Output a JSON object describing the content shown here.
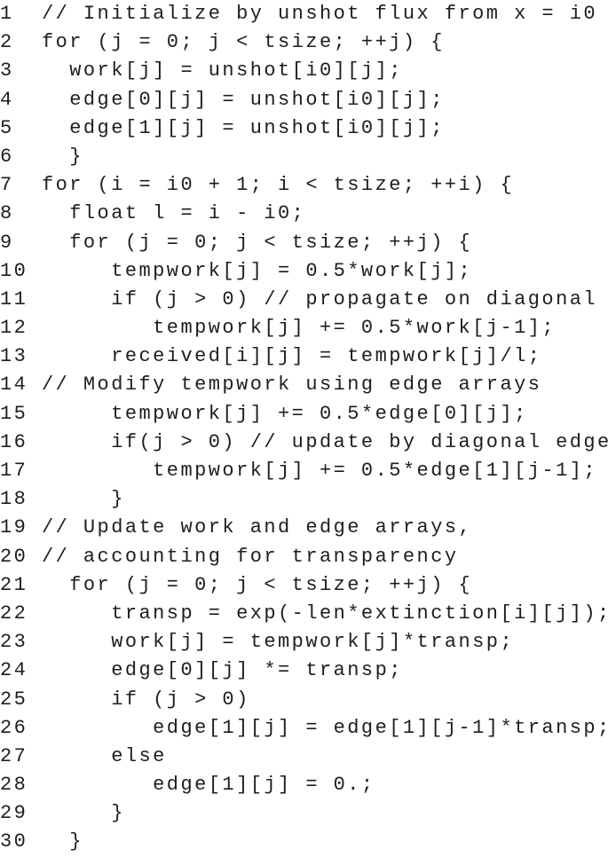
{
  "code_listing": {
    "lines": [
      {
        "number": "1",
        "code": "// Initialize by unshot flux from x = i0"
      },
      {
        "number": "2",
        "code": "for (j = 0; j < tsize; ++j) {"
      },
      {
        "number": "3",
        "code": "  work[j] = unshot[i0][j];"
      },
      {
        "number": "4",
        "code": "  edge[0][j] = unshot[i0][j];"
      },
      {
        "number": "5",
        "code": "  edge[1][j] = unshot[i0][j];"
      },
      {
        "number": "6",
        "code": "  }"
      },
      {
        "number": "7",
        "code": "for (i = i0 + 1; i < tsize; ++i) {"
      },
      {
        "number": "8",
        "code": "  float l = i - i0;"
      },
      {
        "number": "9",
        "code": "  for (j = 0; j < tsize; ++j) {"
      },
      {
        "number": "10",
        "code": "     tempwork[j] = 0.5*work[j];"
      },
      {
        "number": "11",
        "code": "     if (j > 0) // propagate on diagonal"
      },
      {
        "number": "12",
        "code": "        tempwork[j] += 0.5*work[j-1];"
      },
      {
        "number": "13",
        "code": "     received[i][j] = tempwork[j]/l;"
      },
      {
        "number": "14",
        "code": "// Modify tempwork using edge arrays"
      },
      {
        "number": "15",
        "code": "     tempwork[j] += 0.5*edge[0][j];"
      },
      {
        "number": "16",
        "code": "     if(j > 0) // update by diagonal edge"
      },
      {
        "number": "17",
        "code": "        tempwork[j] += 0.5*edge[1][j-1];"
      },
      {
        "number": "18",
        "code": "     }"
      },
      {
        "number": "19",
        "code": "// Update work and edge arrays,"
      },
      {
        "number": "20",
        "code": "// accounting for transparency"
      },
      {
        "number": "21",
        "code": "  for (j = 0; j < tsize; ++j) {"
      },
      {
        "number": "22",
        "code": "     transp = exp(-len*extinction[i][j]);"
      },
      {
        "number": "23",
        "code": "     work[j] = tempwork[j]*transp;"
      },
      {
        "number": "24",
        "code": "     edge[0][j] *= transp;"
      },
      {
        "number": "25",
        "code": "     if (j > 0)"
      },
      {
        "number": "26",
        "code": "        edge[1][j] = edge[1][j-1]*transp;"
      },
      {
        "number": "27",
        "code": "     else"
      },
      {
        "number": "28",
        "code": "        edge[1][j] = 0.;"
      },
      {
        "number": "29",
        "code": "     }"
      },
      {
        "number": "30",
        "code": "  }"
      }
    ]
  }
}
